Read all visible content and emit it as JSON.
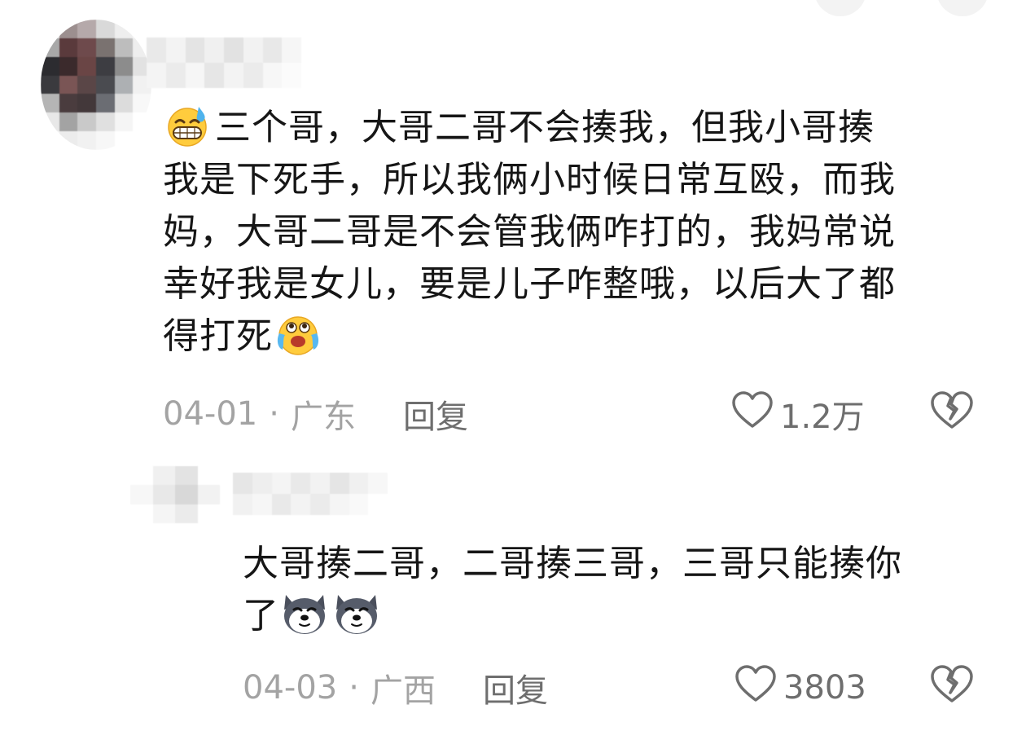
{
  "comments": [
    {
      "text_lines": [
        "三个哥，大哥二哥不会揍我，但我小哥揍",
        "我是下死手，所以我俩小时候日常互殴，而我",
        "妈，大哥二哥是不会管我俩咋打的，我妈常说",
        "幸好我是女儿，要是儿子咋整哦，以后大了都",
        "得打死"
      ],
      "date": "04-01",
      "location": "广东",
      "reply_label": "回复",
      "like_count": "1.2万"
    },
    {
      "text_lines": [
        "大哥揍二哥，二哥揍三哥，三哥只能揍你",
        "了"
      ],
      "date": "04-03",
      "location": "广西",
      "reply_label": "回复",
      "like_count": "3803"
    }
  ],
  "icons": {
    "like": "heart-outline-icon",
    "dislike": "broken-heart-icon",
    "emoji_1": "sweat-grin-emoji",
    "emoji_2": "crying-laugh-emoji",
    "emoji_3": "husky-dog-emoji"
  },
  "colors": {
    "text": "#161616",
    "meta": "#a3a3a3",
    "action": "#6e6e6e"
  }
}
